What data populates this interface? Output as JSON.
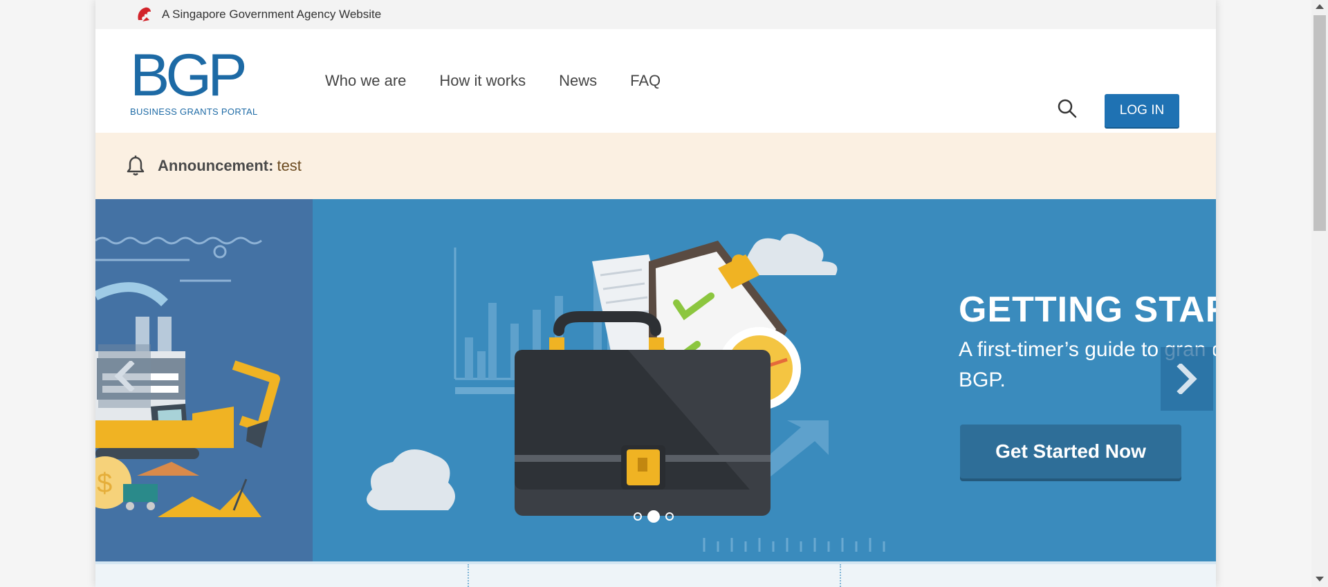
{
  "masthead": {
    "text": "A Singapore Government Agency Website",
    "icon": "lion-head-icon"
  },
  "header": {
    "logo_mark": "BGP",
    "logo_sub": "BUSINESS GRANTS PORTAL",
    "nav": [
      {
        "label": "Who we are"
      },
      {
        "label": "How it works"
      },
      {
        "label": "News"
      },
      {
        "label": "FAQ"
      }
    ],
    "login_label": "LOG IN"
  },
  "announcement": {
    "label": "Announcement:",
    "text": "test"
  },
  "hero": {
    "title": "GETTING START",
    "subtitle": "A first-timer’s guide to gran on BGP.",
    "cta_label": "Get Started Now",
    "active_slide": 2,
    "slide_count": 3
  },
  "colors": {
    "brand": "#1d6aa5",
    "hero_bg": "#3a8bbd",
    "announcement_bg": "#fbf0e2"
  }
}
